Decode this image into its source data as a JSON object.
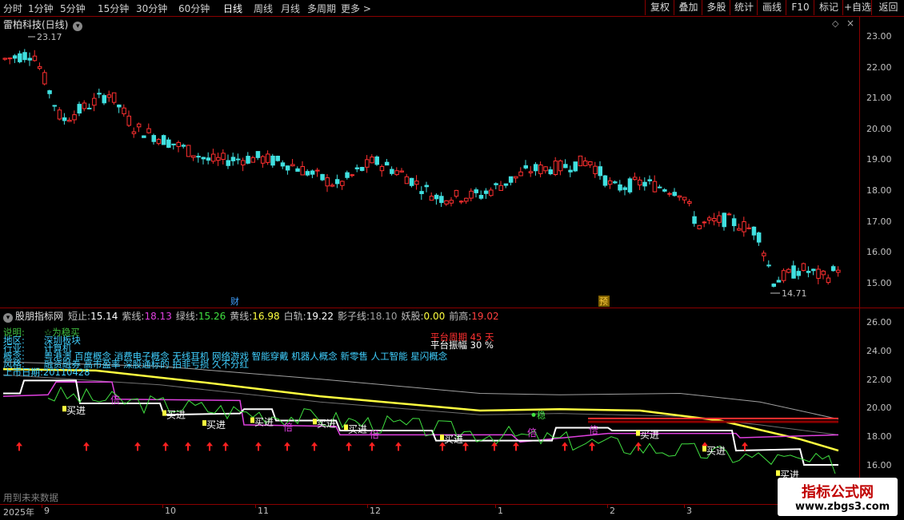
{
  "toolbar": {
    "tabs": [
      "分时",
      "1分钟",
      "5分钟",
      "15分钟",
      "30分钟",
      "60分钟",
      "日线",
      "周线",
      "月线",
      "多周期",
      "更多 >"
    ],
    "active_tab": "日线",
    "right_buttons": [
      "复权",
      "叠加",
      "多股",
      "统计",
      "画线",
      "F10",
      "标记",
      "+自选",
      "返回"
    ]
  },
  "main_chart": {
    "title": "雷柏科技(日线)",
    "high_label": "23.17",
    "low_label": "14.71",
    "markers": [
      "财",
      "预"
    ],
    "y_ticks": [
      "23.00",
      "22.00",
      "21.00",
      "20.00",
      "19.00",
      "18.00",
      "17.00",
      "16.00",
      "15.00"
    ]
  },
  "indicator": {
    "name": "股朋指标网",
    "values": [
      {
        "label": "短止:",
        "value": "15.14",
        "color": "#ffffff"
      },
      {
        "label": "紫线:",
        "value": "18.13",
        "color": "#e040e0"
      },
      {
        "label": "绿线:",
        "value": "15.26",
        "color": "#40e040"
      },
      {
        "label": "黄线:",
        "value": "16.98",
        "color": "#ffff40"
      },
      {
        "label": "白轨:",
        "value": "19.22",
        "color": "#ffffff"
      },
      {
        "label": "影子线:",
        "value": "18.10",
        "color": "#a0a0a0"
      },
      {
        "label": "妖股:",
        "value": "0.00",
        "color": "#ffff40"
      },
      {
        "label": "前高:",
        "value": "19.02",
        "color": "#ff4040"
      }
    ],
    "y_ticks": [
      "26.00",
      "24.00",
      "22.00",
      "20.00",
      "18.00",
      "16.00"
    ],
    "info_lines": [
      {
        "key": "说明:",
        "val": "☆为稳买",
        "color": "#40c040"
      },
      {
        "key": "地区:",
        "val": "深圳板块",
        "color": "#40d0ff"
      },
      {
        "key": "行业:",
        "val": "计算机",
        "color": "#40d0ff"
      },
      {
        "key": "概念:",
        "val": "粤港澳 百度概念 消费电子概念 无线耳机 网络游戏 智能穿戴 机器人概念 新零售 人工智能 星闪概念",
        "color": "#40d0ff"
      },
      {
        "key": "风格:",
        "val": "融资融券 高市盈率 深股通标的 拍非亏损 久不分红",
        "color": "#40d0ff"
      },
      {
        "key": "上市日期:",
        "val": "20110428",
        "color": "#40d0ff"
      }
    ],
    "platform_period": "平台周期 45 天",
    "platform_amplitude": "平台振幅 30 %",
    "buy_label": "买进",
    "double_label": "倍",
    "stable_label": "稳",
    "footer_note": "用到未来数据"
  },
  "date_axis": {
    "labels": [
      "2025年",
      "9",
      "10",
      "11",
      "12",
      "1",
      "2",
      "3"
    ]
  },
  "watermark": {
    "title": "指标公式网",
    "url": "www.zbgs3.com"
  },
  "colors": {
    "up": "#ff3030",
    "down": "#40e0e0",
    "frame": "#8b0000",
    "yellow": "#ffff40",
    "purple": "#e040e0",
    "green": "#40e040"
  }
}
